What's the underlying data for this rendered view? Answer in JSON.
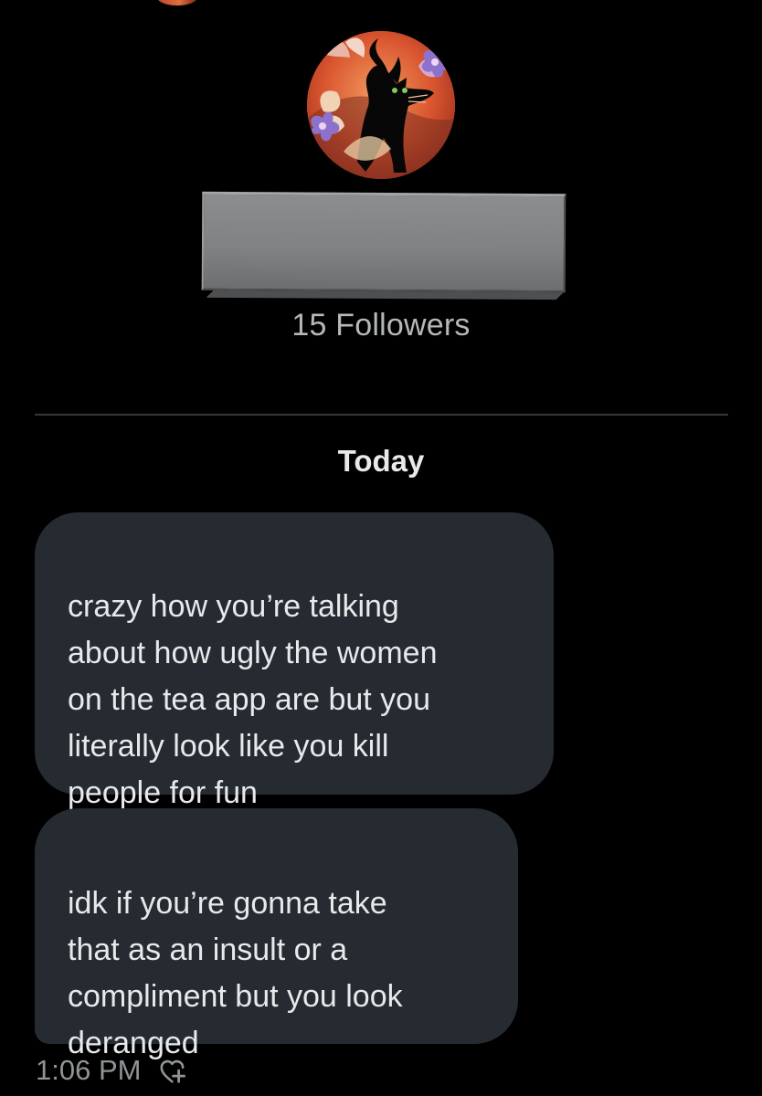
{
  "profile": {
    "followers_text": "15 Followers"
  },
  "conversation": {
    "date_label": "Today",
    "messages": [
      {
        "text": "crazy how you’re talking\nabout how ugly the women\non the tea app are but you\nliterally look like you kill\npeople for fun"
      },
      {
        "text": "idk if you’re gonna take\nthat as an insult or a\ncompliment but you look\nderanged"
      }
    ],
    "last_message_time": "1:06 PM"
  },
  "icons": {
    "profile_avatar": "black-cat-flower-painting-icon",
    "reaction": "heart-plus-icon"
  },
  "colors": {
    "background": "#000000",
    "bubble": "#252b31",
    "primary_text": "#e7e9ea",
    "secondary_text": "#8f9497"
  }
}
